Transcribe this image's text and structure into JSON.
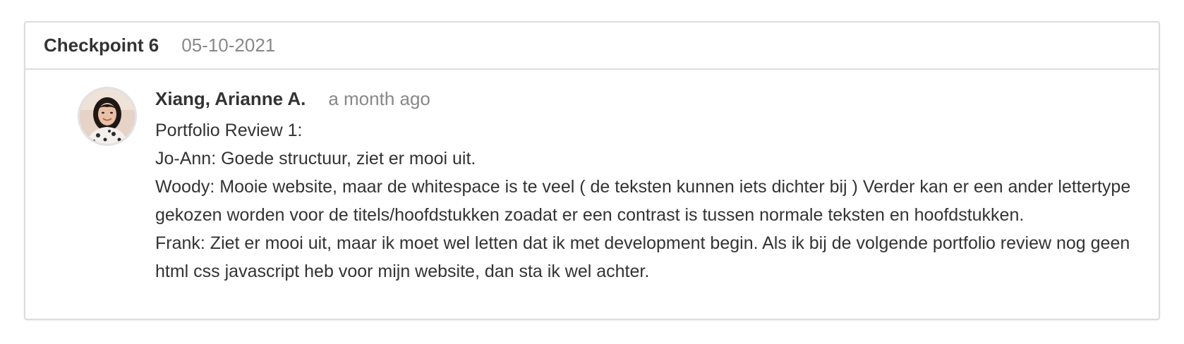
{
  "checkpoint": {
    "title": "Checkpoint 6",
    "date": "05-10-2021"
  },
  "comment": {
    "avatar_icon": "user-photo-avatar",
    "author": "Xiang, Arianne A.",
    "time_ago": "a month ago",
    "lines": [
      "Portfolio Review 1:",
      "Jo-Ann: Goede structuur, ziet er mooi uit.",
      "Woody: Mooie website, maar de whitespace is te veel ( de teksten kunnen iets dichter bij ) Verder kan er een ander lettertype gekozen worden voor de titels/hoofdstukken zoadat er een contrast is tussen normale teksten en hoofdstukken.",
      "Frank: Ziet er mooi uit, maar ik moet wel letten dat ik met development begin. Als ik bij de volgende portfolio review nog geen html css javascript heb voor mijn website, dan sta ik wel achter."
    ]
  },
  "colors": {
    "border": "#dddddd",
    "text": "#333333",
    "muted": "#888888"
  }
}
